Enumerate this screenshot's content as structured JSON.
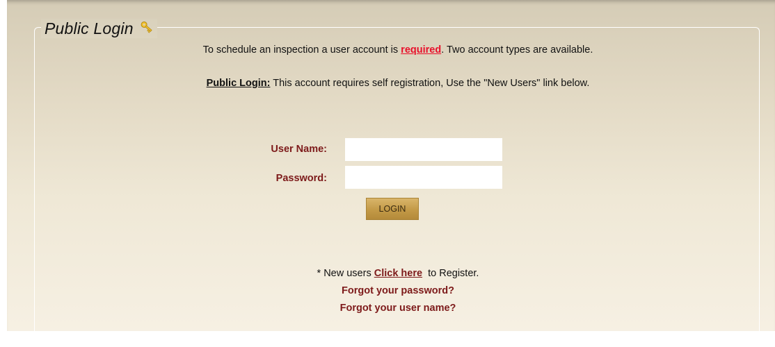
{
  "legend": {
    "title": "Public Login",
    "icon": "key-icon"
  },
  "intro": {
    "before": "To schedule an inspection a user account is ",
    "required": "required",
    "after": ". Two account types are available."
  },
  "public_login_note": {
    "label": "Public Login:",
    "text": " This account requires self registration, Use the \"New Users\" link below."
  },
  "form": {
    "username_label": "User Name:",
    "password_label": "Password:",
    "username_value": "",
    "password_value": "",
    "login_button": "LOGIN"
  },
  "links": {
    "new_users_prefix": "* New users ",
    "click_here": "Click here",
    "new_users_suffix": "  to Register.",
    "forgot_password": "Forgot your password?",
    "forgot_username": "Forgot your user name?"
  },
  "colors": {
    "label_color": "#7d1a1a",
    "required_color": "#e8102a",
    "button_gold": "#c39a47"
  }
}
